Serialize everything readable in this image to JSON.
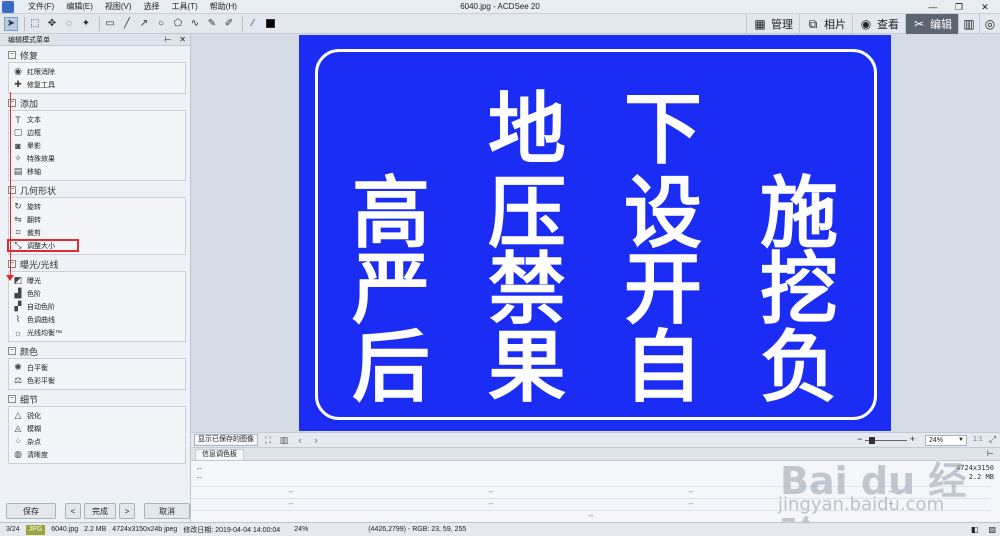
{
  "window": {
    "title": "6040.jpg - ACDSee 20",
    "menu": [
      "文件(F)",
      "编辑(E)",
      "视图(V)",
      "选择",
      "工具(T)",
      "帮助(H)"
    ],
    "controls": [
      "—",
      "❐",
      "✕"
    ]
  },
  "modes": {
    "manage": "管理",
    "photos": "相片",
    "view": "查看",
    "edit": "编辑"
  },
  "panel": {
    "title": "编辑模式菜单",
    "pin": "⊢",
    "close": "✕",
    "sections": {
      "repair": {
        "title": "修复",
        "items": [
          "红眼消除",
          "修复工具"
        ]
      },
      "add": {
        "title": "添加",
        "items": [
          "文本",
          "边框",
          "晕影",
          "特殊效果",
          "移轴"
        ]
      },
      "geometry": {
        "title": "几何形状",
        "items": [
          "旋转",
          "翻转",
          "裁剪",
          "调整大小"
        ]
      },
      "exposure": {
        "title": "曝光/光线",
        "items": [
          "曝光",
          "色阶",
          "自动色阶",
          "色调曲线",
          "光线均衡™"
        ]
      },
      "color": {
        "title": "颜色",
        "items": [
          "白平衡",
          "色彩平衡"
        ]
      },
      "detail": {
        "title": "细节",
        "items": [
          "锐化",
          "模糊",
          "杂点",
          "清晰度"
        ]
      }
    },
    "buttons": {
      "save": "保存",
      "prev": "<",
      "done": "完成",
      "next": ">",
      "cancel": "取消"
    }
  },
  "sign": {
    "line1": [
      "地",
      "下"
    ],
    "line2": [
      "高",
      "压",
      "设",
      "施"
    ],
    "line3": [
      "严",
      "禁",
      "开",
      "挖"
    ],
    "line4": [
      "后",
      "果",
      "自",
      "负"
    ],
    "background": "#1b2cf4"
  },
  "imagebar": {
    "show_saved": "显示已保存的图像",
    "zoom": "24%",
    "ratio": "1:1"
  },
  "info": {
    "tab": "信息调色板",
    "top_left": [
      "--",
      "--"
    ],
    "dims": "4724x3150",
    "size": "2.2 MB",
    "rows": [
      [
        "--",
        "--",
        "--",
        "--"
      ],
      [
        "--",
        "--",
        "--",
        "--"
      ],
      [
        "--"
      ]
    ]
  },
  "status": {
    "index": "3/24",
    "format": "JPG",
    "filename": "6040.jpg",
    "filesize": "2.2 MB",
    "details": "4724x3150x24b jpeg",
    "modified": "修改日期: 2019-04-04 14:00:04",
    "zoom": "24%",
    "pixel": "(4426,2799) - RGB: 23, 59, 255"
  },
  "watermark": {
    "brand": "Bai du 经验",
    "url": "jingyan.baidu.com"
  }
}
